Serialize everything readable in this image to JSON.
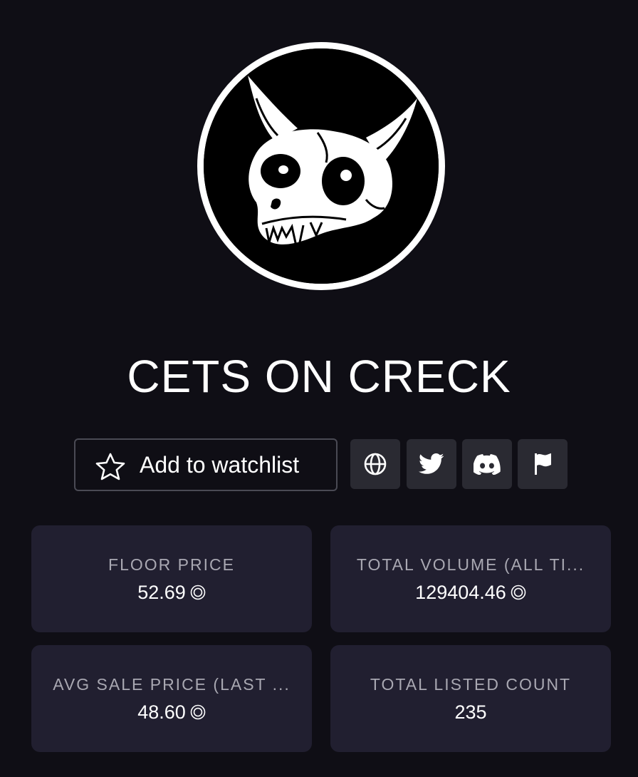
{
  "collection": {
    "name": "CETS ON CRECK"
  },
  "actions": {
    "watchlist_label": "Add to watchlist",
    "icons": [
      "globe-icon",
      "twitter-icon",
      "discord-icon",
      "flag-icon"
    ]
  },
  "stats": [
    {
      "label": "FLOOR PRICE",
      "value": "52.69",
      "currency_icon": "coin-icon"
    },
    {
      "label": "TOTAL VOLUME (ALL TI...",
      "value": "129404.46",
      "currency_icon": "coin-icon"
    },
    {
      "label": "AVG SALE PRICE (LAST ...",
      "value": "48.60",
      "currency_icon": "coin-icon"
    },
    {
      "label": "TOTAL LISTED COUNT",
      "value": "235"
    }
  ],
  "colors": {
    "background": "#0f0e15",
    "card": "#211f30",
    "icon_button": "#2a2a32",
    "label": "#a9a8b2",
    "text": "#ffffff"
  }
}
